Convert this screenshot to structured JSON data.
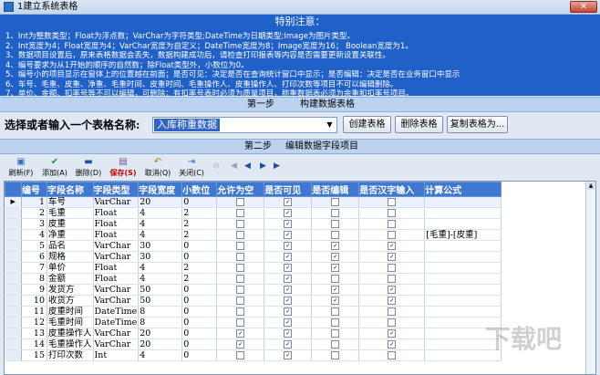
{
  "window": {
    "title": "1建立系统表格",
    "close_label": "✕"
  },
  "notice": {
    "title": "特别注意：",
    "lines": [
      "1、Int为整数类型；Float为浮点数；VarChar为字符类型;DateTime为日期类型;Image为图片类型。",
      "2、Int宽度为4；Float宽度为4；VarChar宽度为自定义；DateTime宽度为8；Image宽度为16；    Boolean宽度为1。",
      "3、数据项目设置后，原来表格数据会丢失，数据构建成功后，请检查打印报表等内容是否需要更新设置关联性。",
      "4、编号要求为从1开始的顺序的自然数；除Float类型外，小数位为0。",
      "5、编号小的项目显示在窗体上的位置越在前面；是否可见：决定是否在查询统计窗口中显示；是否编辑：决定是否在业务窗口中显示",
      "6、车号、毛重、皮重、净重、毛重时间、皮重时间、毛重操作人、皮重操作人、打印次数等项目不可以编辑删除。",
      "7、单价、金额、扣率号等不可以编辑，可删除；有扣率号表时必须为质量项目，称重数据表必须为余重和扣率号项目。"
    ]
  },
  "step1": {
    "label": "第一步",
    "title": "构建数据表格"
  },
  "table_name": {
    "label": "选择或者输入一个表格名称:",
    "value": "入库称重数据"
  },
  "buttons": {
    "create": "创建表格",
    "delete": "删除表格",
    "copy": "复制表格为..."
  },
  "step2": {
    "label": "第二步",
    "title": "编辑数据字段项目"
  },
  "toolbar": [
    {
      "icon": "new-icon",
      "glyph": "▣",
      "label": "刷新(F)"
    },
    {
      "icon": "check-icon",
      "glyph": "✔",
      "label": "添加(A)"
    },
    {
      "icon": "minus-icon",
      "glyph": "▬",
      "label": "删除(D)"
    },
    {
      "icon": "save-icon",
      "glyph": "▤",
      "label": "保存(S)"
    },
    {
      "icon": "undo-icon",
      "glyph": "↶",
      "label": "取消(Q)"
    },
    {
      "icon": "exit-icon",
      "glyph": "⇥",
      "label": "关闭(C)"
    }
  ],
  "grid": {
    "columns": [
      "编号",
      "字段名称",
      "字段类型",
      "字段宽度",
      "小数位",
      "允许为空",
      "是否可见",
      "是否编辑",
      "是否汉字输入",
      "计算公式"
    ],
    "rows": [
      {
        "indicator": "▶",
        "no": "1",
        "name": "车号",
        "type": "VarChar",
        "width": "20",
        "dec": "0",
        "null": false,
        "visible": true,
        "edit": false,
        "cn": false,
        "formula": ""
      },
      {
        "indicator": "",
        "no": "2",
        "name": "毛重",
        "type": "Float",
        "width": "4",
        "dec": "2",
        "null": false,
        "visible": true,
        "edit": false,
        "cn": false,
        "formula": ""
      },
      {
        "indicator": "",
        "no": "3",
        "name": "皮重",
        "type": "Float",
        "width": "4",
        "dec": "2",
        "null": false,
        "visible": true,
        "edit": false,
        "cn": false,
        "formula": ""
      },
      {
        "indicator": "",
        "no": "4",
        "name": "净重",
        "type": "Float",
        "width": "4",
        "dec": "2",
        "null": false,
        "visible": true,
        "edit": false,
        "cn": false,
        "formula": "[毛重]-[皮重]"
      },
      {
        "indicator": "",
        "no": "5",
        "name": "品名",
        "type": "VarChar",
        "width": "30",
        "dec": "0",
        "null": false,
        "visible": true,
        "edit": true,
        "cn": true,
        "formula": ""
      },
      {
        "indicator": "",
        "no": "6",
        "name": "规格",
        "type": "VarChar",
        "width": "30",
        "dec": "0",
        "null": false,
        "visible": true,
        "edit": true,
        "cn": true,
        "formula": ""
      },
      {
        "indicator": "",
        "no": "7",
        "name": "单价",
        "type": "Float",
        "width": "4",
        "dec": "2",
        "null": false,
        "visible": true,
        "edit": true,
        "cn": false,
        "formula": ""
      },
      {
        "indicator": "",
        "no": "8",
        "name": "金额",
        "type": "Float",
        "width": "4",
        "dec": "2",
        "null": false,
        "visible": true,
        "edit": false,
        "cn": false,
        "formula": ""
      },
      {
        "indicator": "",
        "no": "9",
        "name": "发货方",
        "type": "VarChar",
        "width": "50",
        "dec": "0",
        "null": false,
        "visible": true,
        "edit": true,
        "cn": true,
        "formula": ""
      },
      {
        "indicator": "",
        "no": "10",
        "name": "收货方",
        "type": "VarChar",
        "width": "50",
        "dec": "0",
        "null": false,
        "visible": true,
        "edit": true,
        "cn": true,
        "formula": ""
      },
      {
        "indicator": "",
        "no": "11",
        "name": "皮重时间",
        "type": "DateTime",
        "width": "8",
        "dec": "0",
        "null": false,
        "visible": true,
        "edit": false,
        "cn": false,
        "formula": ""
      },
      {
        "indicator": "",
        "no": "12",
        "name": "毛重时间",
        "type": "DateTime",
        "width": "8",
        "dec": "0",
        "null": false,
        "visible": true,
        "edit": false,
        "cn": false,
        "formula": ""
      },
      {
        "indicator": "",
        "no": "13",
        "name": "皮重操作人",
        "type": "VarChar",
        "width": "20",
        "dec": "0",
        "null": true,
        "visible": true,
        "edit": false,
        "cn": true,
        "formula": ""
      },
      {
        "indicator": "",
        "no": "14",
        "name": "毛重操作人",
        "type": "VarChar",
        "width": "20",
        "dec": "0",
        "null": true,
        "visible": true,
        "edit": false,
        "cn": true,
        "formula": ""
      },
      {
        "indicator": "",
        "no": "15",
        "name": "打印次数",
        "type": "Int",
        "width": "4",
        "dec": "0",
        "null": false,
        "visible": true,
        "edit": false,
        "cn": false,
        "formula": ""
      }
    ]
  },
  "colors": {
    "notice_bg": "#1f60c9",
    "header_bg": "#3f78d0",
    "accent": "#3163c5"
  }
}
